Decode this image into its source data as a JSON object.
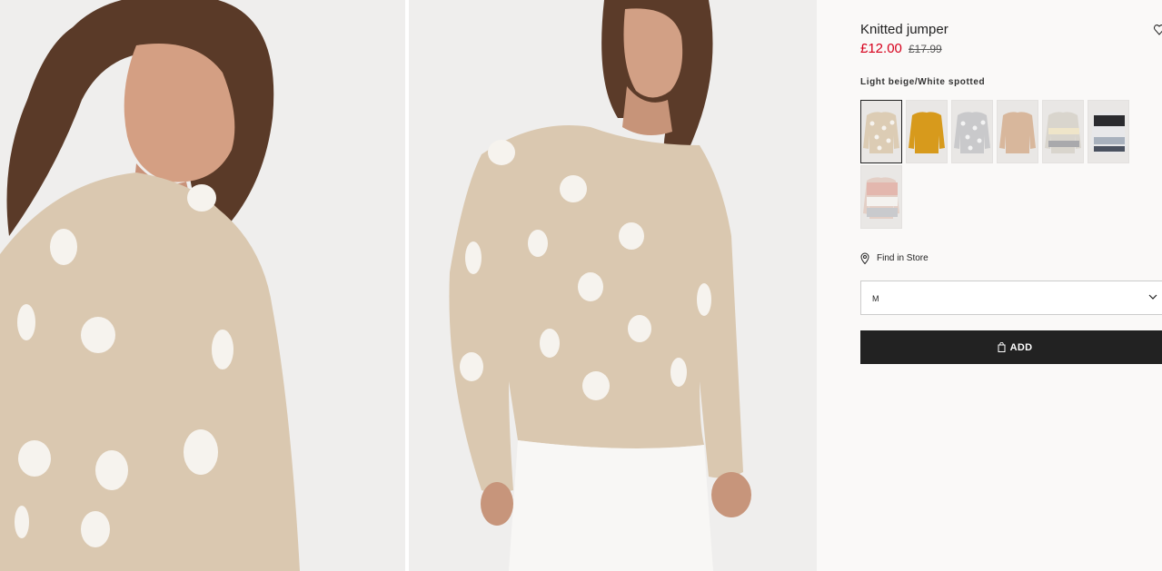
{
  "product": {
    "title": "Knitted jumper",
    "price": "£12.00",
    "old_price": "£17.99",
    "color_name": "Light beige/White spotted"
  },
  "swatches": [
    {
      "name": "beige-dots",
      "base": "#dcccb4",
      "accent": "#f6f3ee",
      "pattern": "dots",
      "selected": true
    },
    {
      "name": "mustard",
      "base": "#d79a1c",
      "accent": "#b57d10",
      "pattern": "plain"
    },
    {
      "name": "grey-dots",
      "base": "#c9c9cb",
      "accent": "#f3f3f3",
      "pattern": "dots"
    },
    {
      "name": "beige",
      "base": "#d8b79c",
      "accent": "#c7a489",
      "pattern": "plain"
    },
    {
      "name": "beige-grey-stripe",
      "base": "#d9d5cd",
      "accent": "#a9a9ac",
      "pattern": "stripe"
    },
    {
      "name": "black-white-grey-stripe",
      "base": "#e8e8ea",
      "accent": "#2b2b2e",
      "pattern": "stripe2"
    },
    {
      "name": "pink-grey-stripe",
      "base": "#e3cfc6",
      "accent": "#c9cacd",
      "pattern": "stripe3"
    }
  ],
  "store": {
    "label": "Find in Store",
    "icon": "location-pin-icon"
  },
  "size": {
    "selected": "M"
  },
  "add_button": {
    "label": "ADD",
    "icon": "shopping-bag-icon"
  },
  "colors": {
    "price": "#d6001c",
    "button_bg": "#222222",
    "background": "#faf9f8"
  }
}
